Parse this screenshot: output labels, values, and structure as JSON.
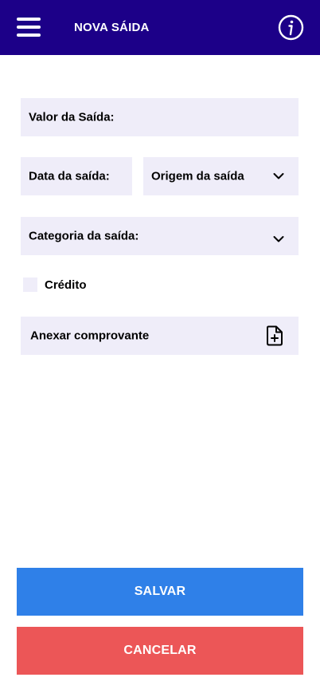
{
  "header": {
    "title": "NOVA SÁIDA"
  },
  "form": {
    "valor_label": "Valor da Saída:",
    "data_label": "Data da saída:",
    "origem_label": "Origem da saída",
    "categoria_label": "Categoria da saída:",
    "credito_label": "Crédito",
    "anexar_label": "Anexar comprovante"
  },
  "actions": {
    "save_label": "SALVAR",
    "cancel_label": "CANCELAR"
  },
  "icons": {
    "menu": "hamburger-menu-icon",
    "info": "info-icon",
    "dropdown": "chevron-down-icon",
    "attach": "file-plus-icon"
  },
  "colors": {
    "header_bg": "#1c0088",
    "field_bg": "#efedf9",
    "save_bg": "#2f80e8",
    "cancel_bg": "#ec5657"
  }
}
